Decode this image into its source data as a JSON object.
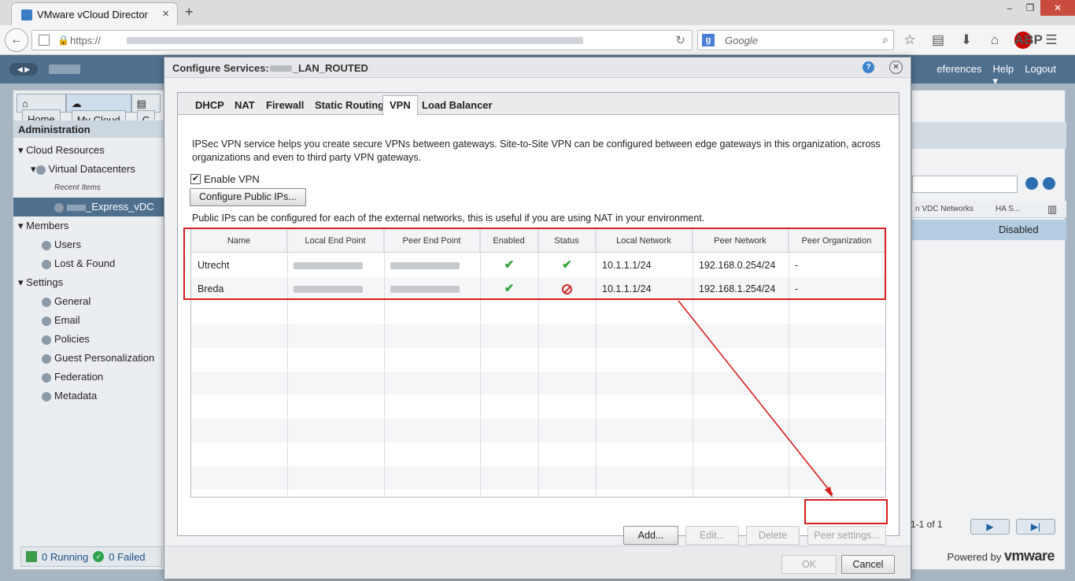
{
  "browser": {
    "tab_title": "VMware vCloud Director",
    "url_prefix": "https://",
    "search_placeholder": "Google",
    "abp_label": "ABP"
  },
  "header": {
    "links": [
      "eferences",
      "Help",
      "Logout"
    ]
  },
  "left_panel": {
    "top_tabs": [
      "Home",
      "My Cloud",
      "C"
    ],
    "admin_title": "Administration",
    "tree": [
      {
        "label": "Cloud Resources",
        "level": 0,
        "icon": "triangle-down-icon"
      },
      {
        "label": "Virtual Datacenters",
        "level": 1,
        "icon": "datacenter-icon"
      },
      {
        "label": "Recent Items",
        "level": 2,
        "icon": ""
      },
      {
        "label": "_Express_vDC",
        "level": 2,
        "icon": "vdc-icon",
        "selected": true
      },
      {
        "label": "Members",
        "level": 0,
        "icon": "triangle-down-icon"
      },
      {
        "label": "Users",
        "level": 1,
        "icon": "user-icon"
      },
      {
        "label": "Lost & Found",
        "level": 1,
        "icon": "user-icon"
      },
      {
        "label": "Settings",
        "level": 0,
        "icon": "triangle-down-icon"
      },
      {
        "label": "General",
        "level": 1,
        "icon": "gear-icon"
      },
      {
        "label": "Email",
        "level": 1,
        "icon": "gear-icon"
      },
      {
        "label": "Policies",
        "level": 1,
        "icon": "gear-icon"
      },
      {
        "label": "Guest Personalization",
        "level": 1,
        "icon": "gear-icon"
      },
      {
        "label": "Federation",
        "level": 1,
        "icon": "gear-icon"
      },
      {
        "label": "Metadata",
        "level": 1,
        "icon": "gear-icon"
      }
    ],
    "status_running": "0 Running",
    "status_failed": "0 Failed"
  },
  "right_panel": {
    "col_networks": "n VDC Networks",
    "col_ha": "HA S...",
    "row_value": "Disabled",
    "pager": "1-1 of 1"
  },
  "powered_by": "Powered by",
  "vmware": "vmware",
  "dialog": {
    "title_prefix": "Configure Services:",
    "title_suffix": "_LAN_ROUTED",
    "tabs": [
      "DHCP",
      "NAT",
      "Firewall",
      "Static Routing",
      "VPN",
      "Load Balancer"
    ],
    "active_tab": "VPN",
    "description": "IPSec VPN service helps you create secure VPNs between gateways. Site-to-Site VPN can be configured between edge gateways in this organization, across organizations and even to third party VPN gateways.",
    "enable_vpn_label": "Enable VPN",
    "enable_vpn_checked": true,
    "configure_public_ips": "Configure Public IPs...",
    "public_ips_note": "Public IPs can be configured for each of the external networks, this is useful if you are using NAT in your environment.",
    "columns": [
      "Name",
      "Local End Point",
      "Peer End Point",
      "Enabled",
      "Status",
      "Local Network",
      "Peer Network",
      "Peer Organization"
    ],
    "rows": [
      {
        "name": "Utrecht",
        "enabled": true,
        "status": "ok",
        "local_network": "10.1.1.1/24",
        "peer_network": "192.168.0.254/24",
        "peer_org": "-"
      },
      {
        "name": "Breda",
        "enabled": true,
        "status": "error",
        "local_network": "10.1.1.1/24",
        "peer_network": "192.168.1.254/24",
        "peer_org": "-"
      }
    ],
    "buttons": {
      "add": "Add...",
      "edit": "Edit...",
      "delete": "Delete",
      "peer_settings": "Peer settings..."
    },
    "ok": "OK",
    "cancel": "Cancel"
  },
  "colors": {
    "annotation_red": "#d61f1f",
    "header_blue": "#4f6f8f",
    "check_green": "#2ea43a"
  }
}
